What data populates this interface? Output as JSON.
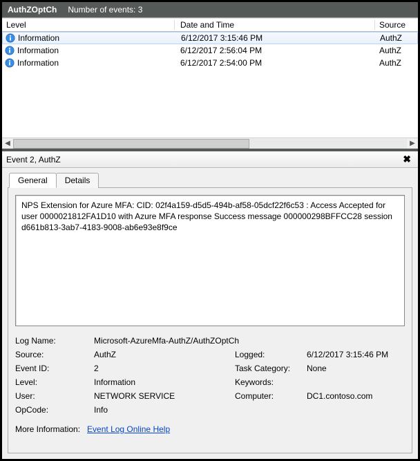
{
  "header": {
    "app_name": "AuthZOptCh",
    "event_count_label": "Number of events: 3"
  },
  "columns": {
    "level": "Level",
    "date": "Date and Time",
    "source": "Source"
  },
  "events": [
    {
      "level": "Information",
      "date": "6/12/2017 3:15:46 PM",
      "source": "AuthZ",
      "selected": true
    },
    {
      "level": "Information",
      "date": "6/12/2017 2:56:04 PM",
      "source": "AuthZ",
      "selected": false
    },
    {
      "level": "Information",
      "date": "6/12/2017 2:54:00 PM",
      "source": "AuthZ",
      "selected": false
    }
  ],
  "detail": {
    "title": "Event 2, AuthZ",
    "tabs": {
      "general": "General",
      "details": "Details"
    },
    "message": "NPS Extension for Azure MFA:  CID: 02f4a159-d5d5-494b-af58-05dcf22f6c53 : Access Accepted for user 0000021812FA1D10 with Azure MFA response Success message 000000298BFFCC28 session d661b813-3ab7-4183-9008-ab6e93e8f9ce",
    "props": {
      "log_name_label": "Log Name:",
      "log_name": "Microsoft-AzureMfa-AuthZ/AuthZOptCh",
      "source_label": "Source:",
      "source": "AuthZ",
      "logged_label": "Logged:",
      "logged": "6/12/2017 3:15:46 PM",
      "event_id_label": "Event ID:",
      "event_id": "2",
      "task_cat_label": "Task Category:",
      "task_cat": "None",
      "level_label": "Level:",
      "level": "Information",
      "keywords_label": "Keywords:",
      "keywords": "",
      "user_label": "User:",
      "user": "NETWORK SERVICE",
      "computer_label": "Computer:",
      "computer": "DC1.contoso.com",
      "opcode_label": "OpCode:",
      "opcode": "Info",
      "more_info_label": "More Information:",
      "more_info_link": "Event Log Online Help"
    }
  }
}
